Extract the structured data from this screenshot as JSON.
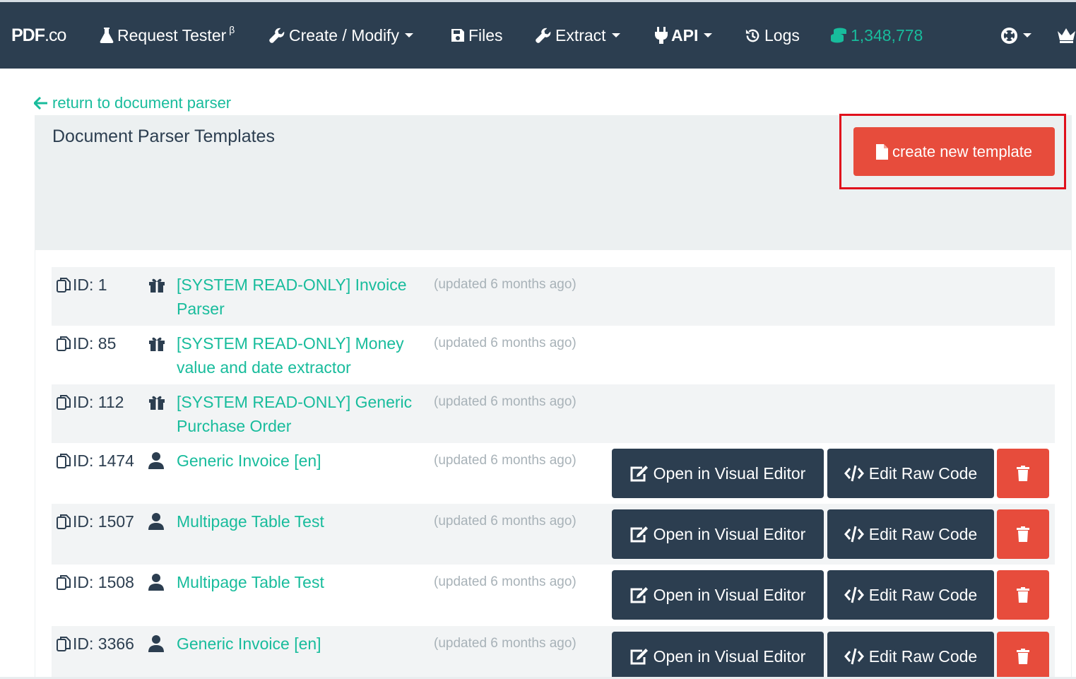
{
  "navbar": {
    "brand_main": "PDF",
    "brand_suffix": ".co",
    "items": [
      {
        "label": "Request Tester",
        "sup": "β",
        "icon": "flask-icon"
      },
      {
        "label": "Create / Modify",
        "icon": "wrench-icon",
        "dropdown": true
      },
      {
        "label": "Files",
        "icon": "floppy-disk-icon"
      },
      {
        "label": "Extract",
        "icon": "wrench-icon",
        "dropdown": true
      },
      {
        "label": "API",
        "icon": "plug-icon",
        "dropdown": true
      },
      {
        "label": "Logs",
        "icon": "history-icon"
      }
    ],
    "credits": "1,348,778",
    "credits_icon": "coins-icon",
    "help_icon": "life-ring-icon",
    "account_icon": "crown-icon"
  },
  "back_link": {
    "label": "return to document parser",
    "icon": "arrow-left-icon"
  },
  "panel": {
    "title": "Document Parser Templates",
    "create_button": {
      "label": "create new template",
      "icon": "file-icon"
    }
  },
  "row_actions": {
    "visual_editor": "Open in Visual Editor",
    "raw_code": "Edit Raw Code"
  },
  "templates": [
    {
      "id_label": "ID: 1",
      "owner": "system",
      "owner_icon": "gift-icon",
      "name": "[SYSTEM READ-ONLY] Invoice Parser",
      "updated": "(updated 6 months ago)",
      "editable": false
    },
    {
      "id_label": "ID: 85",
      "owner": "system",
      "owner_icon": "gift-icon",
      "name": "[SYSTEM READ-ONLY] Money value and date extractor",
      "updated": "(updated 6 months ago)",
      "editable": false
    },
    {
      "id_label": "ID: 112",
      "owner": "system",
      "owner_icon": "gift-icon",
      "name": "[SYSTEM READ-ONLY] Generic Purchase Order",
      "updated": "(updated 6 months ago)",
      "editable": false
    },
    {
      "id_label": "ID: 1474",
      "owner": "user",
      "owner_icon": "user-icon",
      "name": "Generic Invoice [en]",
      "updated": "(updated 6 months ago)",
      "editable": true
    },
    {
      "id_label": "ID: 1507",
      "owner": "user",
      "owner_icon": "user-icon",
      "name": "Multipage Table Test",
      "updated": "(updated 6 months ago)",
      "editable": true
    },
    {
      "id_label": "ID: 1508",
      "owner": "user",
      "owner_icon": "user-icon",
      "name": "Multipage Table Test",
      "updated": "(updated 6 months ago)",
      "editable": true
    },
    {
      "id_label": "ID: 3366",
      "owner": "user",
      "owner_icon": "user-icon",
      "name": "Generic Invoice [en]",
      "updated": "(updated 6 months ago)",
      "editable": true
    }
  ],
  "colors": {
    "navbar": "#2c3e50",
    "accent": "#18bc9c",
    "danger": "#e74c3c",
    "panel": "#ecf0f1",
    "highlight": "#e0101c"
  }
}
